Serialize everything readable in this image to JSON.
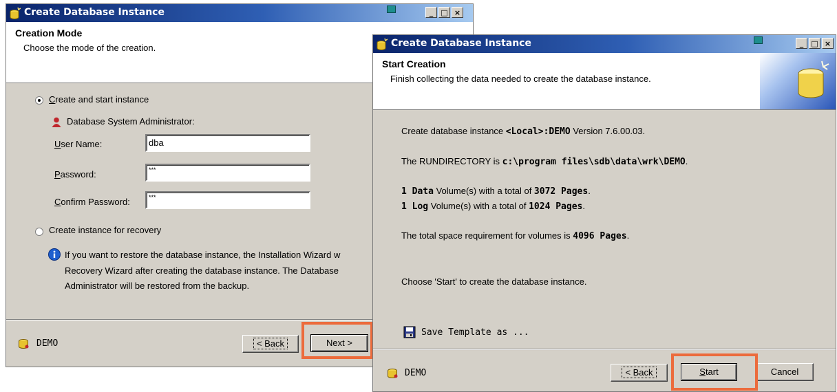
{
  "left_window": {
    "title": "Create Database Instance",
    "header_title": "Creation Mode",
    "header_subtitle": "Choose the mode of the creation.",
    "radio_create_start": "Create and start instance",
    "admin_label": "Database System Administrator:",
    "user_name_label": "User Name:",
    "user_name_value": "dba",
    "password_label": "Password:",
    "password_value": "***",
    "confirm_password_label": "Confirm Password:",
    "confirm_password_value": "***",
    "radio_recovery": "Create instance for recovery",
    "info_line1": "If you want to restore the database instance, the Installation Wizard w",
    "info_line2": "Recovery Wizard after creating the database instance. The Database",
    "info_line3": "Administrator will be restored from the backup.",
    "footer_instance": "DEMO",
    "back_button": "< Back",
    "next_button": "Next >"
  },
  "right_window": {
    "title": "Create Database Instance",
    "header_title": "Start Creation",
    "header_subtitle": "Finish collecting the data needed to create the database instance.",
    "line1_a": "Create  database instance ",
    "line1_b": "<Local>:DEMO",
    "line1_c": " Version 7.6.00.03.",
    "line2_a": "The RUNDIRECTORY is ",
    "line2_b": "c:\\program files\\sdb\\data\\wrk\\DEMO",
    "line2_c": ".",
    "line3_a": "1 Data",
    "line3_b": " Volume(s) with a total of ",
    "line3_c": "3072 Pages",
    "line3_d": ".",
    "line4_a": "1 Log",
    "line4_b": " Volume(s) with a total of ",
    "line4_c": "1024 Pages",
    "line4_d": ".",
    "line5_a": "The total space requirement for volumes is ",
    "line5_b": "4096 Pages",
    "line5_c": ".",
    "line6": "Choose 'Start' to create  the database instance.",
    "save_template": "Save Template as ...",
    "footer_instance": "DEMO",
    "back_button": "< Back",
    "start_button": "Start",
    "cancel_button": "Cancel"
  },
  "colors": {
    "title_gradient_start": "#0a246a",
    "title_gradient_end": "#a6caf0",
    "dialog_face": "#d4d0c8",
    "highlight_box": "#ec6b3c"
  }
}
